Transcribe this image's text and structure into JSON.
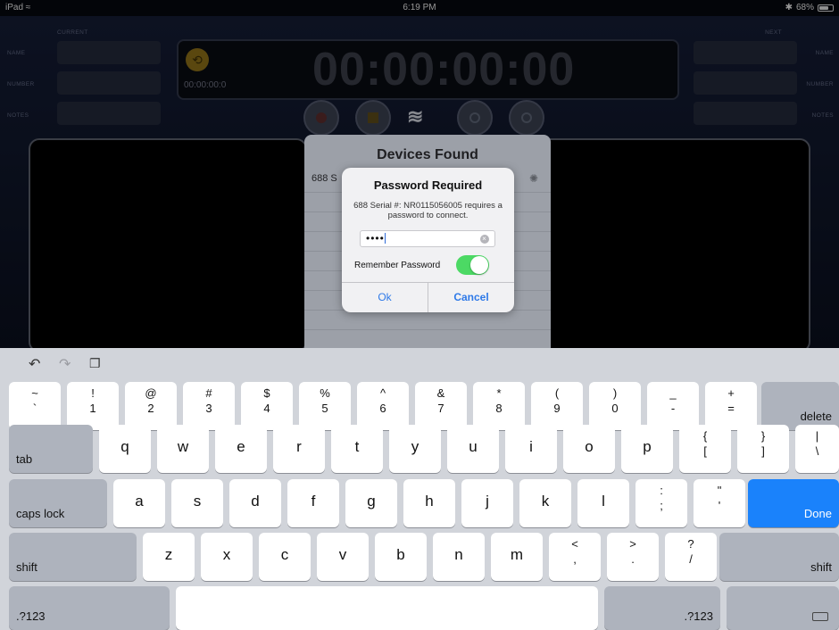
{
  "status_bar": {
    "device": "iPad",
    "time": "6:19 PM",
    "battery": "68%",
    "battery_level": 0.68
  },
  "recorder": {
    "current_label": "CURRENT",
    "next_label": "NEXT",
    "left_fields": [
      "NAME",
      "NUMBER",
      "NOTES"
    ],
    "right_fields": [
      "NAME",
      "NUMBER",
      "NOTES"
    ],
    "timecode": "00:00:00:00",
    "sub_timecode": "00:00:00:0"
  },
  "devices_panel": {
    "title": "Devices Found",
    "item_partial": "688 S"
  },
  "alert": {
    "title": "Password Required",
    "message": "688 Serial #: NR0115056005 requires a password to connect.",
    "password_value": "••••",
    "remember_label": "Remember Password",
    "remember_on": true,
    "ok_label": "Ok",
    "cancel_label": "Cancel"
  },
  "keyboard": {
    "row1": [
      {
        "top": "~",
        "bot": "`"
      },
      {
        "top": "!",
        "bot": "1"
      },
      {
        "top": "@",
        "bot": "2"
      },
      {
        "top": "#",
        "bot": "3"
      },
      {
        "top": "$",
        "bot": "4"
      },
      {
        "top": "%",
        "bot": "5"
      },
      {
        "top": "^",
        "bot": "6"
      },
      {
        "top": "&",
        "bot": "7"
      },
      {
        "top": "*",
        "bot": "8"
      },
      {
        "top": "(",
        "bot": "9"
      },
      {
        "top": ")",
        "bot": "0"
      },
      {
        "top": "_",
        "bot": "-"
      },
      {
        "top": "+",
        "bot": "="
      }
    ],
    "delete": "delete",
    "tab": "tab",
    "row2": [
      "q",
      "w",
      "e",
      "r",
      "t",
      "y",
      "u",
      "i",
      "o",
      "p"
    ],
    "row2_sym": [
      {
        "top": "{",
        "bot": "["
      },
      {
        "top": "}",
        "bot": "]"
      },
      {
        "top": "|",
        "bot": "\\"
      }
    ],
    "caps_lock": "caps lock",
    "row3": [
      "a",
      "s",
      "d",
      "f",
      "g",
      "h",
      "j",
      "k",
      "l"
    ],
    "row3_sym": [
      {
        "top": ":",
        "bot": ";"
      },
      {
        "top": "\"",
        "bot": "'"
      }
    ],
    "done": "Done",
    "shift": "shift",
    "row4": [
      "z",
      "x",
      "c",
      "v",
      "b",
      "n",
      "m"
    ],
    "row4_sym": [
      {
        "top": "<",
        "bot": ","
      },
      {
        "top": ">",
        "bot": "."
      },
      {
        "top": "?",
        "bot": "/"
      }
    ],
    "numbers": ".?123",
    "icons": {
      "undo": "undo-icon",
      "redo": "redo-icon",
      "paste": "paste-icon",
      "hide": "keyboard-hide-icon"
    }
  }
}
